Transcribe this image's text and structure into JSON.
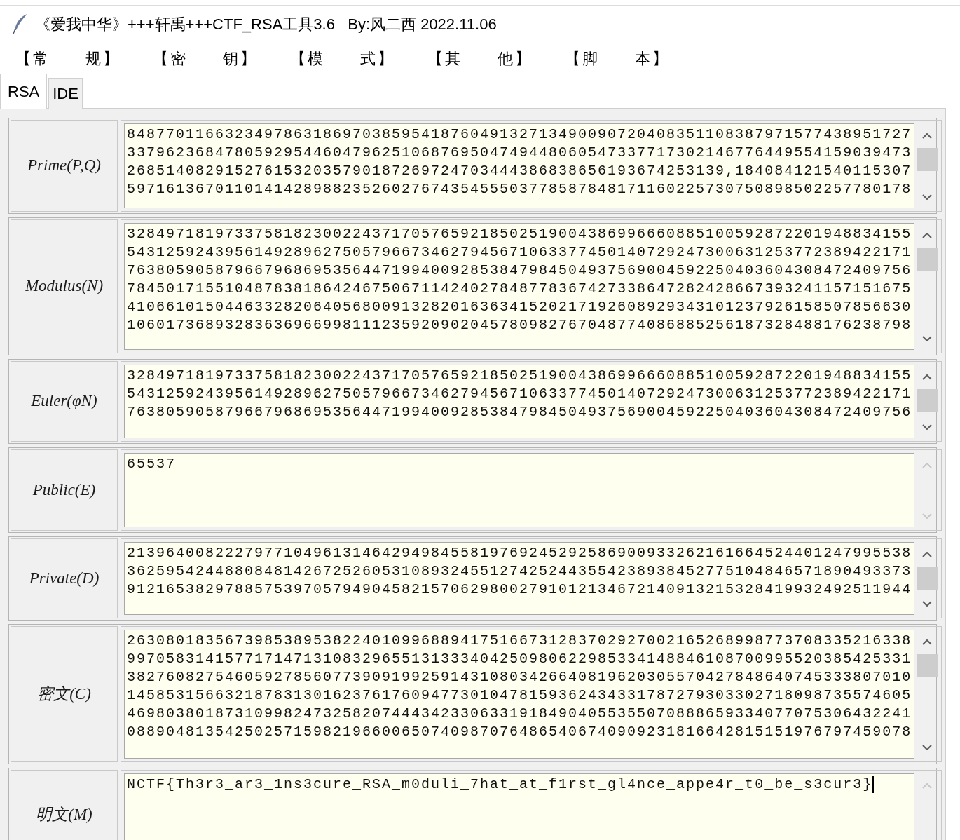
{
  "window": {
    "title": "《爱我中华》+++轩禹+++CTF_RSA工具3.6   By:风二西 2022.11.06"
  },
  "menu": [
    "【常　　规】",
    "【密　　钥】",
    "【模　　式】",
    "【其　　他】",
    "【脚　　本】"
  ],
  "tabs": [
    {
      "label": "RSA",
      "selected": true
    },
    {
      "label": "IDE",
      "selected": false
    }
  ],
  "fields": [
    {
      "label": "Prime(P,Q)",
      "value": "84877011663234978631869703859541876049132713490090720408351108387971577438951727337962368478059295446047962510687695047494480605473377173021467764495541590394732685140829152761532035790187269724703444386838656193674253139,18408412154011530759716136701101414289882352602767435455503778587848171160225730750898502257780178",
      "scrollable": true,
      "focused": false
    },
    {
      "label": "Modulus(N)",
      "value": "328497181973375818230022437170576592185025190043869966608851005928722019488341555431259243956149289627505796673462794567106337745014072924730063125377238942217176380590587966796869535644719940092853847984504937569004592250403604308472409756784501715510487838186424675067114240278487783674273386472824286673932411571516754106610150446332820640568009132820163634152021719260892934310123792615850785663010601736893283636966998111235920902045780982767048774086885256187328488176238798",
      "scrollable": true,
      "focused": false
    },
    {
      "label": "Euler(φN)",
      "value": "328497181973375818230022437170576592185025190043869966608851005928722019488341555431259243956149289627505796673462794567106337745014072924730063125377238942217176380590587966796869535644719940092853847984504937569004592250403604308472409756",
      "scrollable": true,
      "focused": false
    },
    {
      "label": "Public(E)",
      "value": "65537",
      "scrollable": false,
      "focused": false
    },
    {
      "label": "Private(D)",
      "value": "213964008222797710496131464294984558197692452925869009332621616645244012479955383625954244880848142672526053108932455127425244355423893845277510484657189049337391216538297885753970579490458215706298002791012134672140913215328419932492511944",
      "scrollable": true,
      "focused": false
    },
    {
      "label": "密文(C)",
      "value": "263080183567398538953822401099688941751667312837029270021652689987737083352163389970583141577171471310832965513133340425098062298533414884610870099552038542533138276082754605927856077390919925914310803426640819620305570427848640745333807010145853156632187831301623761760947730104781593624343317872793033027180987355746054698038018731099824732582074443423306331918490405535507088865933407707530643224108890481354250257159821966006507409870764865406740909231816642815151976797459078",
      "scrollable": true,
      "focused": false
    },
    {
      "label": "明文(M)",
      "value": "NCTF{Th3r3_ar3_1ns3cure_RSA_m0duli_7hat_at_f1rst_gl4nce_appe4r_t0_be_s3cur3}",
      "scrollable": false,
      "focused": true
    }
  ]
}
